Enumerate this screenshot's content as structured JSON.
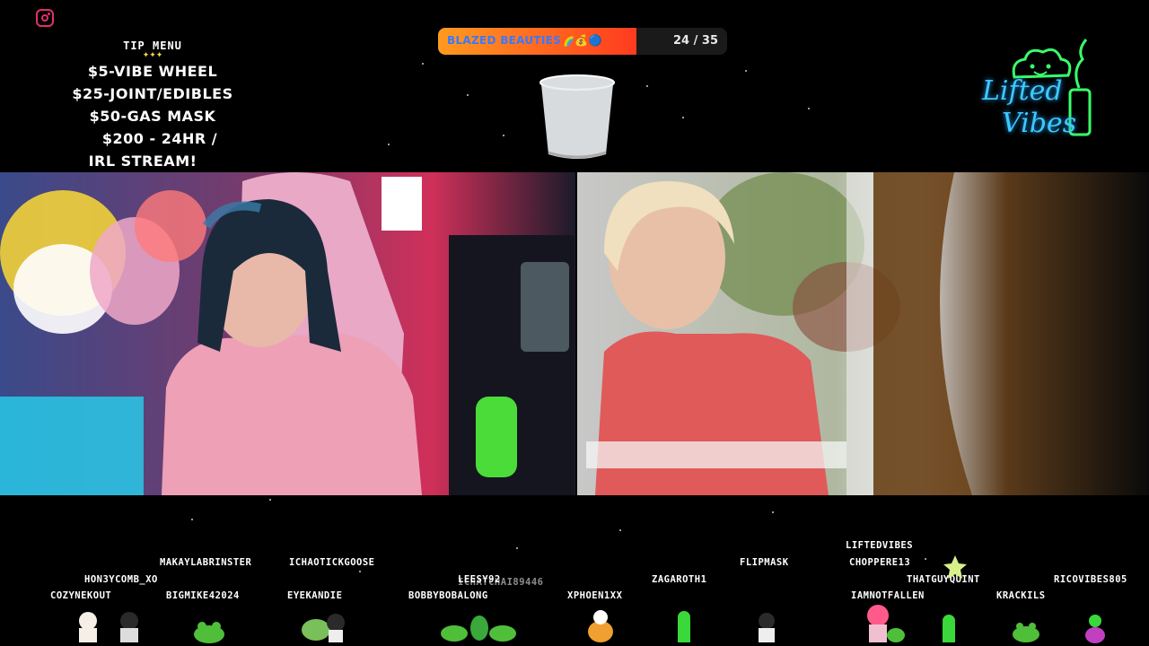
{
  "overlay": {
    "instagram_icon": "instagram-icon",
    "tip_menu": {
      "title": "TIP MENU",
      "stars": "✦✦✦",
      "items": [
        "$5-VIBE WHEEL",
        "$25-JOINT/EDIBLES",
        "$50-GAS MASK",
        "$200 - 24HR /",
        "IRL STREAM!"
      ]
    },
    "goal": {
      "label": "BLAZED BEAUTIES🌈💰🔵",
      "count": "24 / 35",
      "progress": 0.686,
      "fill_color": "#ff6a1f",
      "label_color": "#3a78ff"
    },
    "logo": {
      "line1": "Lifted",
      "line2": "Vibes",
      "color": "#3fc8ff",
      "accent": "#39ff6a"
    }
  },
  "chatters": [
    "MAKAYLABRINSTER",
    "ICHAOTICKGOOSE",
    "HON3YCOMB_XO",
    "COZYNEKOUT",
    "BIGMIKE42024",
    "EYEKANDIE",
    "LEESY92",
    "ICHATCHAI89446",
    "BOBBYBOBALONG",
    "ZAGAROTH1",
    "XPHOEN1XX",
    "FLIPMASK",
    "LIFTEDVIBES",
    "CHOPPERE13",
    "THATGUYQUINT",
    "RICOVIBES805",
    "IAMNOTFALLEN",
    "KRACKILS"
  ]
}
